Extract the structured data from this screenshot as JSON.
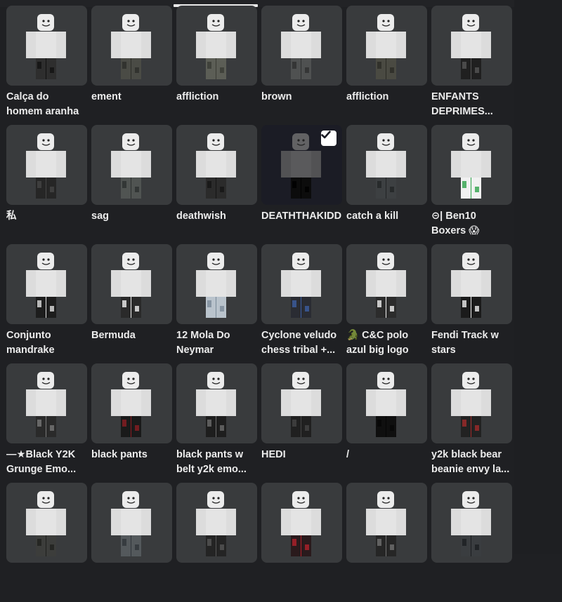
{
  "items": [
    {
      "name": "Calça do homem aranha",
      "pants": "#2e2e2e",
      "accent": "#111111",
      "selected": false
    },
    {
      "name": "ement",
      "pants": "#4a4b45",
      "accent": "#2c2d29",
      "selected": false
    },
    {
      "name": "affliction",
      "pants": "#5c5e56",
      "accent": "#3a3b35",
      "selected": false
    },
    {
      "name": "brown",
      "pants": "#4f5151",
      "accent": "#2e3030",
      "selected": false
    },
    {
      "name": "affliction",
      "pants": "#4a4a42",
      "accent": "#2a2a25",
      "selected": false
    },
    {
      "name": "ENFANTS DEPRIMES...",
      "pants": "#202020",
      "accent": "#555555",
      "selected": false
    },
    {
      "name": "私",
      "pants": "#262626",
      "accent": "#454545",
      "selected": false
    },
    {
      "name": "sag",
      "pants": "#505452",
      "accent": "#2c302f",
      "selected": false
    },
    {
      "name": "deathwish",
      "pants": "#2b2b2b",
      "accent": "#151515",
      "selected": false
    },
    {
      "name": "DEATHTHAKIDD",
      "pants": "#0c0c0c",
      "accent": "#000000",
      "selected": true
    },
    {
      "name": "catch a kill",
      "pants": "#3d4042",
      "accent": "#222426",
      "selected": false
    },
    {
      "name": "⊝| Ben10 Boxers 😱",
      "pants": "#f1f1f1",
      "accent": "#2fa34b",
      "selected": false
    },
    {
      "name": "Conjunto mandrake",
      "pants": "#1d1d1d",
      "accent": "#e0e0e0",
      "selected": false
    },
    {
      "name": "Bermuda",
      "pants": "#2a2a2a",
      "accent": "#f0f0f0",
      "selected": false
    },
    {
      "name": "12 Mola Do Neymar",
      "pants": "#b9c3cc",
      "accent": "#7a8a99",
      "selected": false
    },
    {
      "name": "Cyclone veludo chess tribal +...",
      "pants": "#2a2c33",
      "accent": "#3c5ea0",
      "selected": false
    },
    {
      "name": "🐊 C&C polo azul big logo",
      "pants": "#2c2c2c",
      "accent": "#f0f0f0",
      "selected": false
    },
    {
      "name": "Fendi Track w stars",
      "pants": "#1b1b1b",
      "accent": "#eeeeee",
      "selected": false
    },
    {
      "name": "—★Black Y2K Grunge Emo...",
      "pants": "#2a2a2a",
      "accent": "#777777",
      "selected": false
    },
    {
      "name": "black pants",
      "pants": "#1a1a1a",
      "accent": "#8a1d22",
      "selected": false
    },
    {
      "name": "black pants w belt y2k emo...",
      "pants": "#1e1e1e",
      "accent": "#6b6b6b",
      "selected": false
    },
    {
      "name": "HEDI",
      "pants": "#202020",
      "accent": "#444444",
      "selected": false
    },
    {
      "name": "/",
      "pants": "#0f0f0f",
      "accent": "#060606",
      "selected": false
    },
    {
      "name": "y2k black bear beanie envy la...",
      "pants": "#222222",
      "accent": "#a02a2a",
      "selected": false
    },
    {
      "name": "",
      "pants": "#3c3d3b",
      "accent": "#1f201e",
      "selected": false
    },
    {
      "name": "",
      "pants": "#54595c",
      "accent": "#30343a",
      "selected": false
    },
    {
      "name": "",
      "pants": "#242424",
      "accent": "#555555",
      "selected": false
    },
    {
      "name": "",
      "pants": "#2a1a1c",
      "accent": "#b0202a",
      "selected": false
    },
    {
      "name": "",
      "pants": "#262626",
      "accent": "#707070",
      "selected": false
    },
    {
      "name": "",
      "pants": "#3a3d40",
      "accent": "#1c1e20",
      "selected": false
    }
  ]
}
